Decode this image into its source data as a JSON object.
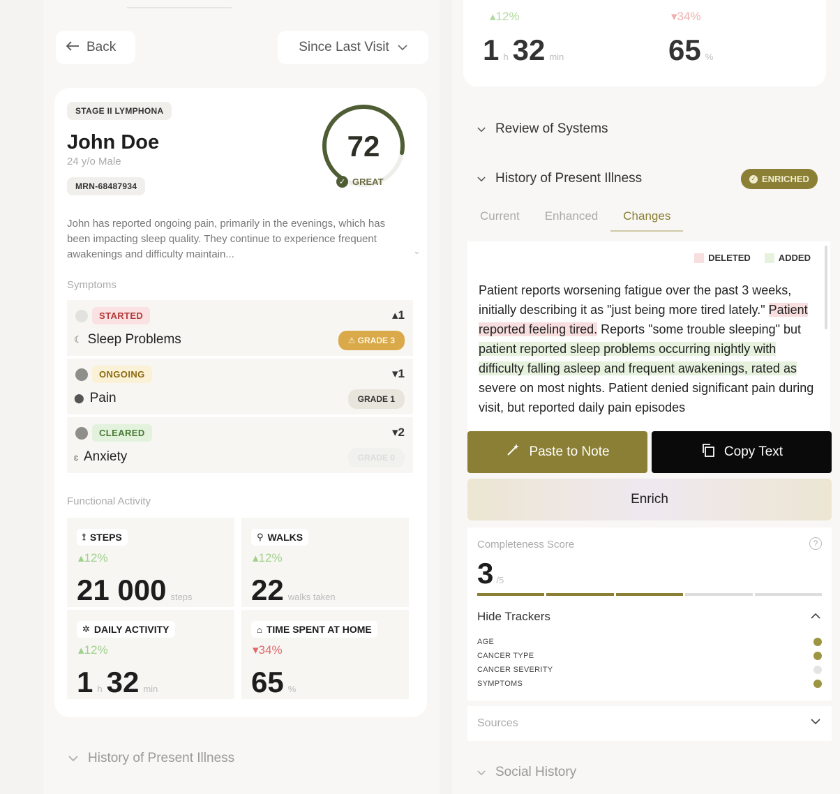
{
  "left": {
    "back_label": "Back",
    "since_label": "Since Last Visit",
    "patient": {
      "stage": "STAGE II LYMPHONA",
      "name": "John Doe",
      "age_sex": "24 y/o Male",
      "mrn": "MRN-68487934",
      "score": "72",
      "score_label": "GREAT",
      "score_fraction": 0.72,
      "summary": "John has reported ongoing pain, primarily in the evenings, which has been impacting sleep quality. They continue to experience frequent awakenings and difficulty maintain..."
    },
    "symptoms_label": "Symptoms",
    "symptoms": [
      {
        "status": "STARTED",
        "trend": "▴1",
        "name": "Sleep Problems",
        "grade": "⚠ GRADE 3"
      },
      {
        "status": "ONGOING",
        "trend": "▾1",
        "name": "Pain",
        "grade": "GRADE 1"
      },
      {
        "status": "CLEARED",
        "trend": "▾2",
        "name": "Anxiety",
        "grade": "GRADE 0"
      }
    ],
    "functional_label": "Functional Activity",
    "activities": [
      {
        "label": "STEPS",
        "change": "▴12%",
        "whole": "21 000",
        "unit": "steps"
      },
      {
        "label": "WALKS",
        "change": "▴12%",
        "whole": "22",
        "unit": "walks taken"
      },
      {
        "label": "DAILY ACTIVITY",
        "change": "▴12%",
        "whole": "1",
        "sub": "h",
        "whole2": "32",
        "unit": "min"
      },
      {
        "label": "TIME SPENT AT HOME",
        "change": "▾34%",
        "whole": "65",
        "unit": "%"
      }
    ],
    "hpi_label": "History of Present Illness"
  },
  "right": {
    "top": {
      "change1": "▴12%",
      "change2": "▾34%",
      "v1a": "1",
      "v1sub": "h",
      "v1b": "32",
      "v1unit": "min",
      "v2": "65",
      "v2unit": "%"
    },
    "ros_label": "Review of Systems",
    "hpi_label": "History of Present Illness",
    "enriched_label": "ENRICHED",
    "tabs": [
      "Current",
      "Enhanced",
      "Changes"
    ],
    "legend": {
      "deleted": "DELETED",
      "added": "ADDED"
    },
    "note": {
      "p1": "Patient reports worsening fatigue over the past 3 weeks, initially describing it as \"just being more tired lately.\" ",
      "del1": "Patient reported feeling tired.",
      "p2": " Reports \"some trouble sleeping\" but ",
      "add1": "patient reported sleep problems occurring nightly with difficulty falling asleep and frequent awakenings, rated as",
      "p3": " severe on most nights. Patient denied significant pain during visit, but reported daily pain episodes"
    },
    "paste_label": "Paste to Note",
    "copy_label": "Copy Text",
    "enrich_label": "Enrich",
    "completeness": {
      "title": "Completeness Score",
      "value": "3",
      "denom": "/5",
      "filled": 3,
      "total": 5,
      "hide_label": "Hide Trackers",
      "trackers": [
        {
          "name": "AGE",
          "done": true
        },
        {
          "name": "CANCER TYPE",
          "done": true
        },
        {
          "name": "CANCER SEVERITY",
          "done": false
        },
        {
          "name": "SYMPTOMS",
          "done": true
        }
      ]
    },
    "sources_label": "Sources",
    "social_label": "Social History"
  },
  "colors": {
    "accent": "#8a7f34",
    "score_ring": "#4f5d34",
    "started_bg": "#fbe2e2",
    "started_fg": "#b43a3a",
    "ongoing_bg": "#fbf1d6",
    "ongoing_fg": "#8a6b12",
    "cleared_bg": "#e3f2dd",
    "cleared_fg": "#4a7a34",
    "up": "#9fd18b",
    "down": "#e36a6a"
  }
}
